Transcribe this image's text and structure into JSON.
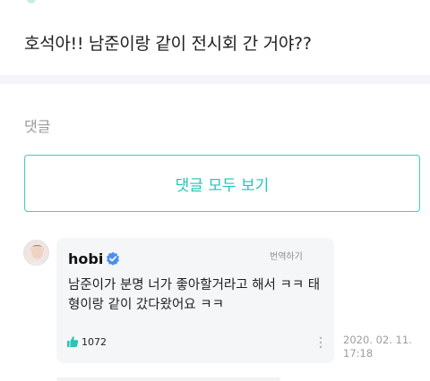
{
  "post": {
    "text": "호석아!! 남준이랑 같이 전시회 간 거야??"
  },
  "comments_section": {
    "label": "댓글",
    "view_all_label": "댓글 모두 보기"
  },
  "comment": {
    "author": "hobi",
    "translate_label": "번역하기",
    "body": "남준이가 분명 너가 좋아할거라고 해서 ㅋㅋ 태형이랑 같이 갔다왔어요 ㅋㅋ",
    "like_count": "1072",
    "date": "2020. 02. 11.",
    "time": "17:18"
  },
  "colors": {
    "accent": "#22c6b4",
    "verified": "#4a8ef6",
    "bubble": "#f5f6f8"
  },
  "icons": {
    "verified": "verified-badge-icon",
    "like": "thumbs-up-icon",
    "more": "more-vertical-icon"
  }
}
